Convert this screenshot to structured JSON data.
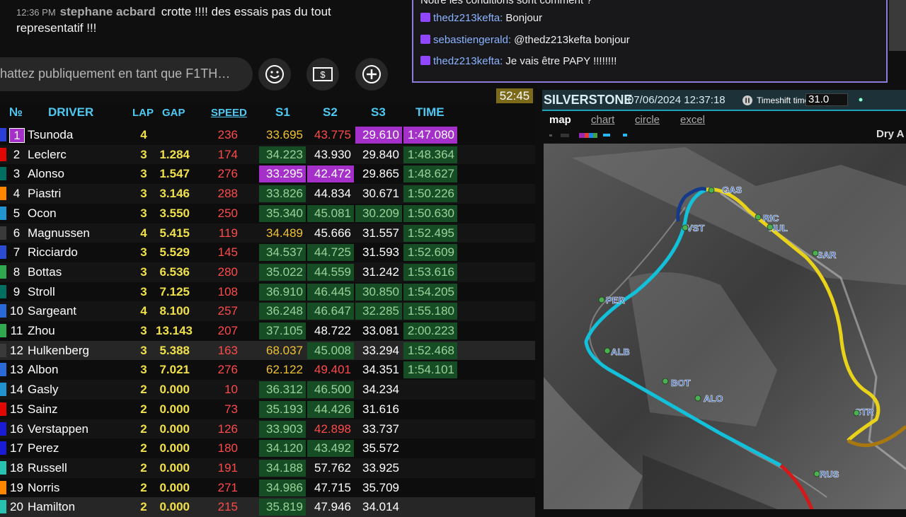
{
  "youtube_chat": {
    "message": {
      "time": "12:36 PM",
      "author": "stephane acbard",
      "text": "crotte !!!! des essais pas du tout representatif !!!"
    },
    "input_placeholder": "hattez publiquement en tant que F1TH…"
  },
  "twitch_chat": {
    "partial_top": "Notre les conditions sont comment ?",
    "lines": [
      {
        "user": "thedz213kefta",
        "text": "Bonjour"
      },
      {
        "user": "sebastiengerald",
        "text": "@thedz213kefta bonjour"
      },
      {
        "user": "thedz213kefta",
        "text": "Je vais être PAPY !!!!!!!!"
      }
    ]
  },
  "session_clock": "52:45",
  "timing": {
    "headers": {
      "pos": "№",
      "driver": "DRIVER",
      "lap": "LAP",
      "gap": "GAP",
      "speed": "SPEED",
      "s1": "S1",
      "s2": "S2",
      "s3": "S3",
      "time": "TIME"
    },
    "rows": [
      {
        "pos": "1",
        "driver": "Tsunoda",
        "lap": "4",
        "gap": "",
        "speed": "236",
        "s1": "33.695",
        "s2": "43.775",
        "s3": "29.610",
        "time": "1:47.080",
        "team_color": "#2b3fd6",
        "s1c": "yellow",
        "s2c": "red",
        "s3c": "purple",
        "tc": "purple"
      },
      {
        "pos": "2",
        "driver": "Leclerc",
        "lap": "3",
        "gap": "1.284",
        "speed": "174",
        "s1": "34.223",
        "s2": "43.930",
        "s3": "29.840",
        "time": "1:48.364",
        "team_color": "#e10600",
        "s1c": "green",
        "s2c": "white",
        "s3c": "white",
        "tc": "green"
      },
      {
        "pos": "3",
        "driver": "Alonso",
        "lap": "3",
        "gap": "1.547",
        "speed": "276",
        "s1": "33.295",
        "s2": "42.472",
        "s3": "29.865",
        "time": "1:48.627",
        "team_color": "#006f62",
        "s1c": "purple",
        "s2c": "purple",
        "s3c": "white",
        "tc": "green"
      },
      {
        "pos": "4",
        "driver": "Piastri",
        "lap": "3",
        "gap": "3.146",
        "speed": "288",
        "s1": "33.826",
        "s2": "44.834",
        "s3": "30.671",
        "time": "1:50.226",
        "team_color": "#ff8700",
        "s1c": "green",
        "s2c": "white",
        "s3c": "white",
        "tc": "green"
      },
      {
        "pos": "5",
        "driver": "Ocon",
        "lap": "3",
        "gap": "3.550",
        "speed": "250",
        "s1": "35.340",
        "s2": "45.081",
        "s3": "30.209",
        "time": "1:50.630",
        "team_color": "#2293d1",
        "s1c": "green",
        "s2c": "green",
        "s3c": "green",
        "tc": "green"
      },
      {
        "pos": "6",
        "driver": "Magnussen",
        "lap": "4",
        "gap": "5.415",
        "speed": "119",
        "s1": "34.489",
        "s2": "45.666",
        "s3": "31.557",
        "time": "1:52.495",
        "team_color": "#3a3a3a",
        "s1c": "yellow",
        "s2c": "white",
        "s3c": "white",
        "tc": "green"
      },
      {
        "pos": "7",
        "driver": "Ricciardo",
        "lap": "3",
        "gap": "5.529",
        "speed": "145",
        "s1": "34.537",
        "s2": "44.725",
        "s3": "31.593",
        "time": "1:52.609",
        "team_color": "#2b4bd0",
        "s1c": "green",
        "s2c": "green",
        "s3c": "white",
        "tc": "green"
      },
      {
        "pos": "8",
        "driver": "Bottas",
        "lap": "3",
        "gap": "6.536",
        "speed": "280",
        "s1": "35.022",
        "s2": "44.559",
        "s3": "31.242",
        "time": "1:53.616",
        "team_color": "#2fa84f",
        "s1c": "green",
        "s2c": "green",
        "s3c": "white",
        "tc": "green"
      },
      {
        "pos": "9",
        "driver": "Stroll",
        "lap": "3",
        "gap": "7.125",
        "speed": "108",
        "s1": "36.910",
        "s2": "46.445",
        "s3": "30.850",
        "time": "1:54.205",
        "team_color": "#006f62",
        "s1c": "green",
        "s2c": "green",
        "s3c": "green",
        "tc": "green"
      },
      {
        "pos": "10",
        "driver": "Sargeant",
        "lap": "4",
        "gap": "8.100",
        "speed": "257",
        "s1": "36.248",
        "s2": "46.647",
        "s3": "32.285",
        "time": "1:55.180",
        "team_color": "#2a6ad8",
        "s1c": "green",
        "s2c": "green",
        "s3c": "green",
        "tc": "green"
      },
      {
        "pos": "11",
        "driver": "Zhou",
        "lap": "3",
        "gap": "13.143",
        "speed": "207",
        "s1": "37.105",
        "s2": "48.722",
        "s3": "33.081",
        "time": "2:00.223",
        "team_color": "#2fa84f",
        "s1c": "green",
        "s2c": "white",
        "s3c": "white",
        "tc": "green"
      },
      {
        "pos": "12",
        "driver": "Hulkenberg",
        "lap": "3",
        "gap": "5.388",
        "speed": "163",
        "s1": "68.037",
        "s2": "45.008",
        "s3": "33.294",
        "time": "1:52.468",
        "team_color": "#3a3a3a",
        "s1c": "yellow",
        "s2c": "green",
        "s3c": "white",
        "tc": "green"
      },
      {
        "pos": "13",
        "driver": "Albon",
        "lap": "3",
        "gap": "7.021",
        "speed": "276",
        "s1": "62.122",
        "s2": "49.401",
        "s3": "34.351",
        "time": "1:54.101",
        "team_color": "#2a6ad8",
        "s1c": "yellow",
        "s2c": "red",
        "s3c": "white",
        "tc": "green"
      },
      {
        "pos": "14",
        "driver": "Gasly",
        "lap": "2",
        "gap": "0.000",
        "speed": "10",
        "s1": "36.312",
        "s2": "46.500",
        "s3": "34.234",
        "time": "",
        "team_color": "#2293d1",
        "s1c": "green",
        "s2c": "green",
        "s3c": "white",
        "tc": ""
      },
      {
        "pos": "15",
        "driver": "Sainz",
        "lap": "2",
        "gap": "0.000",
        "speed": "73",
        "s1": "35.193",
        "s2": "44.426",
        "s3": "31.616",
        "time": "",
        "team_color": "#e10600",
        "s1c": "green",
        "s2c": "green",
        "s3c": "white",
        "tc": ""
      },
      {
        "pos": "16",
        "driver": "Verstappen",
        "lap": "2",
        "gap": "0.000",
        "speed": "126",
        "s1": "33.903",
        "s2": "42.898",
        "s3": "33.737",
        "time": "",
        "team_color": "#1a1ad8",
        "s1c": "green",
        "s2c": "red",
        "s3c": "white",
        "tc": ""
      },
      {
        "pos": "17",
        "driver": "Perez",
        "lap": "2",
        "gap": "0.000",
        "speed": "180",
        "s1": "34.120",
        "s2": "43.492",
        "s3": "35.572",
        "time": "",
        "team_color": "#1a1ad8",
        "s1c": "green",
        "s2c": "green",
        "s3c": "white",
        "tc": ""
      },
      {
        "pos": "18",
        "driver": "Russell",
        "lap": "2",
        "gap": "0.000",
        "speed": "191",
        "s1": "34.188",
        "s2": "57.762",
        "s3": "33.925",
        "time": "",
        "team_color": "#27c3b0",
        "s1c": "green",
        "s2c": "white",
        "s3c": "white",
        "tc": ""
      },
      {
        "pos": "19",
        "driver": "Norris",
        "lap": "2",
        "gap": "0.000",
        "speed": "271",
        "s1": "34.986",
        "s2": "47.715",
        "s3": "35.709",
        "time": "",
        "team_color": "#ff8700",
        "s1c": "green",
        "s2c": "white",
        "s3c": "white",
        "tc": ""
      },
      {
        "pos": "20",
        "driver": "Hamilton",
        "lap": "2",
        "gap": "0.000",
        "speed": "215",
        "s1": "35.819",
        "s2": "47.946",
        "s3": "34.014",
        "time": "",
        "team_color": "#27c3b0",
        "s1c": "green",
        "s2c": "white",
        "s3c": "white",
        "tc": ""
      }
    ]
  },
  "map_panel": {
    "track": "SILVERSTONE",
    "datetime": "07/06/2024 12:37:18",
    "timeshift_label": "Timeshift time",
    "timeshift_value": "31.0",
    "tabs": [
      "map",
      "chart",
      "circle",
      "excel"
    ],
    "condition": "Dry A",
    "drivers_on_map": [
      "GAS",
      "RIC",
      "HUL",
      "VST",
      "SAR",
      "PER",
      "ALB",
      "BOT",
      "ALO",
      "STR",
      "RUS"
    ]
  }
}
